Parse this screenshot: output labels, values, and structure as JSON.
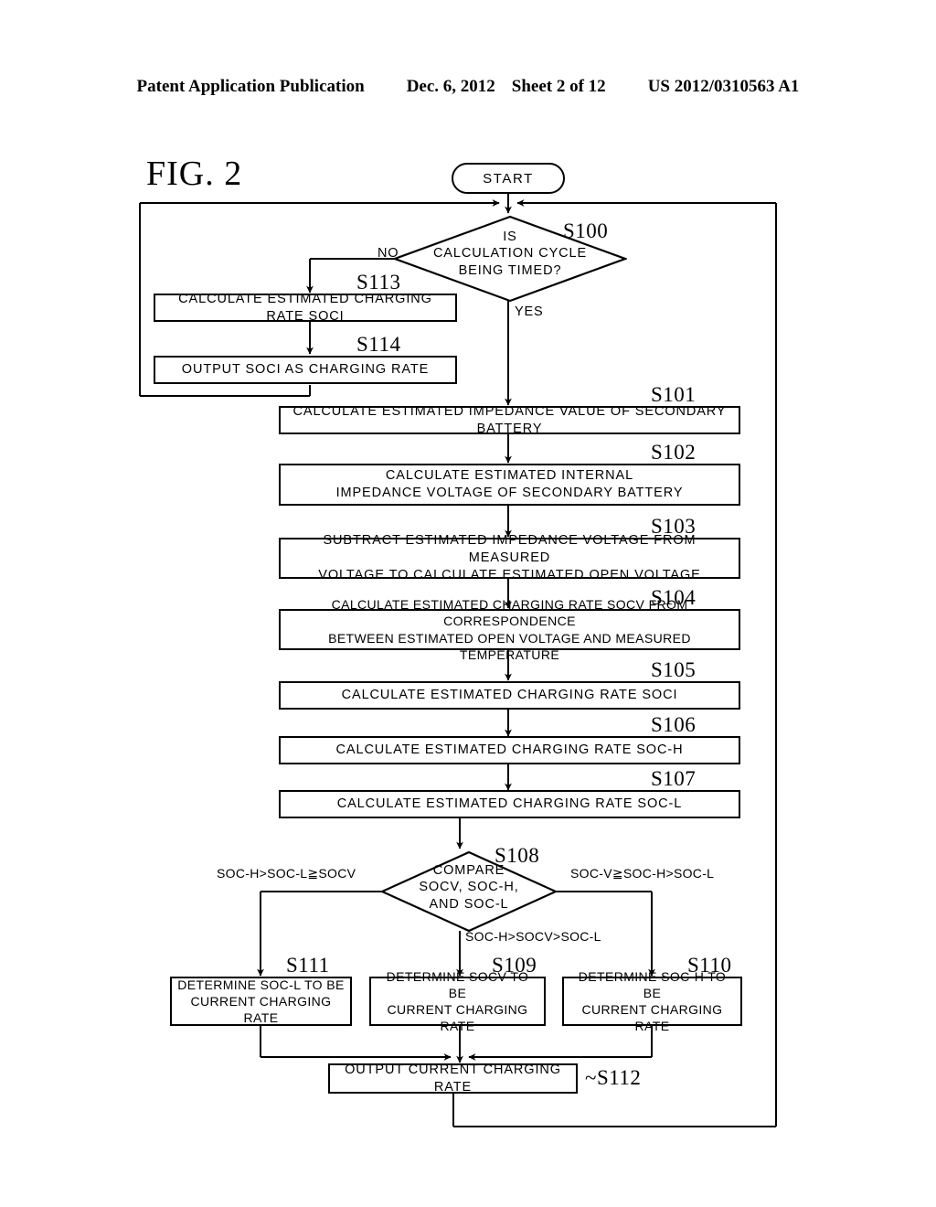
{
  "header": {
    "publication": "Patent Application Publication",
    "date": "Dec. 6, 2012",
    "sheet": "Sheet 2 of 12",
    "number": "US 2012/0310563 A1"
  },
  "figure": {
    "label": "FIG. 2"
  },
  "flowchart": {
    "type": "flowchart",
    "start": {
      "ref": "",
      "text": "START"
    },
    "nodes": [
      {
        "ref": "S100",
        "shape": "decision",
        "text": "IS\nCALCULATION CYCLE\nBEING TIMED?"
      },
      {
        "ref": "S113",
        "shape": "process",
        "text": "CALCULATE ESTIMATED CHARGING RATE SOCI"
      },
      {
        "ref": "S114",
        "shape": "process",
        "text": "OUTPUT SOCI AS CHARGING RATE"
      },
      {
        "ref": "S101",
        "shape": "process",
        "text": "CALCULATE ESTIMATED IMPEDANCE VALUE OF SECONDARY BATTERY"
      },
      {
        "ref": "S102",
        "shape": "process",
        "text": "CALCULATE ESTIMATED INTERNAL\nIMPEDANCE VOLTAGE OF SECONDARY BATTERY"
      },
      {
        "ref": "S103",
        "shape": "process",
        "text": "SUBTRACT ESTIMATED IMPEDANCE VOLTAGE FROM MEASURED\nVOLTAGE TO CALCULATE ESTIMATED OPEN VOLTAGE"
      },
      {
        "ref": "S104",
        "shape": "process",
        "text": "CALCULATE ESTIMATED CHARGING RATE SOCV FROM CORRESPONDENCE\nBETWEEN ESTIMATED OPEN VOLTAGE AND MEASURED TEMPERATURE"
      },
      {
        "ref": "S105",
        "shape": "process",
        "text": "CALCULATE ESTIMATED CHARGING RATE SOCI"
      },
      {
        "ref": "S106",
        "shape": "process",
        "text": "CALCULATE ESTIMATED CHARGING RATE SOC-H"
      },
      {
        "ref": "S107",
        "shape": "process",
        "text": "CALCULATE ESTIMATED CHARGING RATE SOC-L"
      },
      {
        "ref": "S108",
        "shape": "decision",
        "text": "COMPARE\nSOCV, SOC-H,\nAND SOC-L"
      },
      {
        "ref": "S111",
        "shape": "process",
        "text": "DETERMINE SOC-L TO BE\nCURRENT CHARGING RATE"
      },
      {
        "ref": "S109",
        "shape": "process",
        "text": "DETERMINE SOCV TO BE\nCURRENT CHARGING RATE"
      },
      {
        "ref": "S110",
        "shape": "process",
        "text": "DETERMINE SOC-H TO BE\nCURRENT CHARGING RATE"
      },
      {
        "ref": "S112",
        "shape": "process",
        "text": "OUTPUT CURRENT CHARGING RATE"
      }
    ],
    "edge_labels": {
      "s100_no": "NO",
      "s100_yes": "YES",
      "s108_left": "SOC-H>SOC-L≧SOCV",
      "s108_right": "SOC-V≧SOC-H>SOC-L",
      "s108_bottom": "SOC-H>SOCV>SOC-L"
    },
    "colors": {
      "line": "#000000",
      "background": "#ffffff"
    }
  }
}
